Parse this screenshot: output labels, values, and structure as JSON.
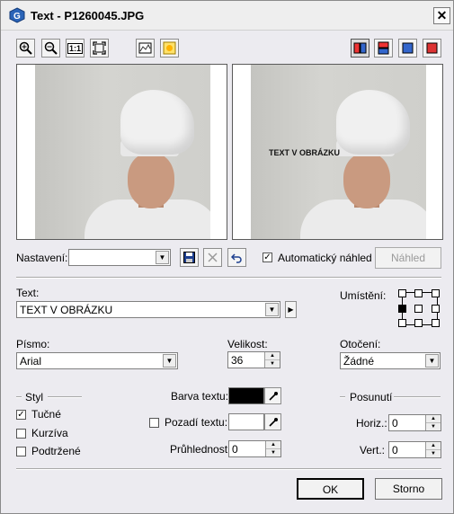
{
  "window": {
    "title": "Text - P1260045.JPG",
    "close": "✕"
  },
  "toolbar": {
    "zoom_in": "zoom-in",
    "zoom_out": "zoom-out",
    "actual_size": "1:1",
    "fit": "fit",
    "histogram": "histogram",
    "brightness": "brightness"
  },
  "preview": {
    "overlay_text": "TEXT V OBRÁZKU"
  },
  "settings": {
    "preset_label": "Nastavení:",
    "preset_value": "",
    "auto_preview_label": "Automatický náhled",
    "auto_preview_checked": true,
    "preview_button": "Náhled"
  },
  "text": {
    "label": "Text:",
    "value": "TEXT V OBRÁZKU"
  },
  "placement": {
    "label": "Umístění:",
    "selected": "middle-left"
  },
  "font": {
    "label": "Písmo:",
    "value": "Arial"
  },
  "size": {
    "label": "Velikost:",
    "value": "36"
  },
  "rotation": {
    "label": "Otočení:",
    "value": "Žádné"
  },
  "style": {
    "label": "Styl",
    "bold": {
      "label": "Tučné",
      "checked": true
    },
    "italic": {
      "label": "Kurzíva",
      "checked": false
    },
    "underline": {
      "label": "Podtržené",
      "checked": false
    }
  },
  "colors": {
    "text_color_label": "Barva textu:",
    "text_color": "#000000",
    "background_label": "Pozadí textu:",
    "background_checked": false,
    "background_color": "#ffffff",
    "opacity_label": "Průhlednost:",
    "opacity_value": "0"
  },
  "offset": {
    "label": "Posunutí",
    "horiz_label": "Horiz.:",
    "horiz_value": "0",
    "vert_label": "Vert.:",
    "vert_value": "0"
  },
  "buttons": {
    "ok": "OK",
    "cancel": "Storno"
  }
}
